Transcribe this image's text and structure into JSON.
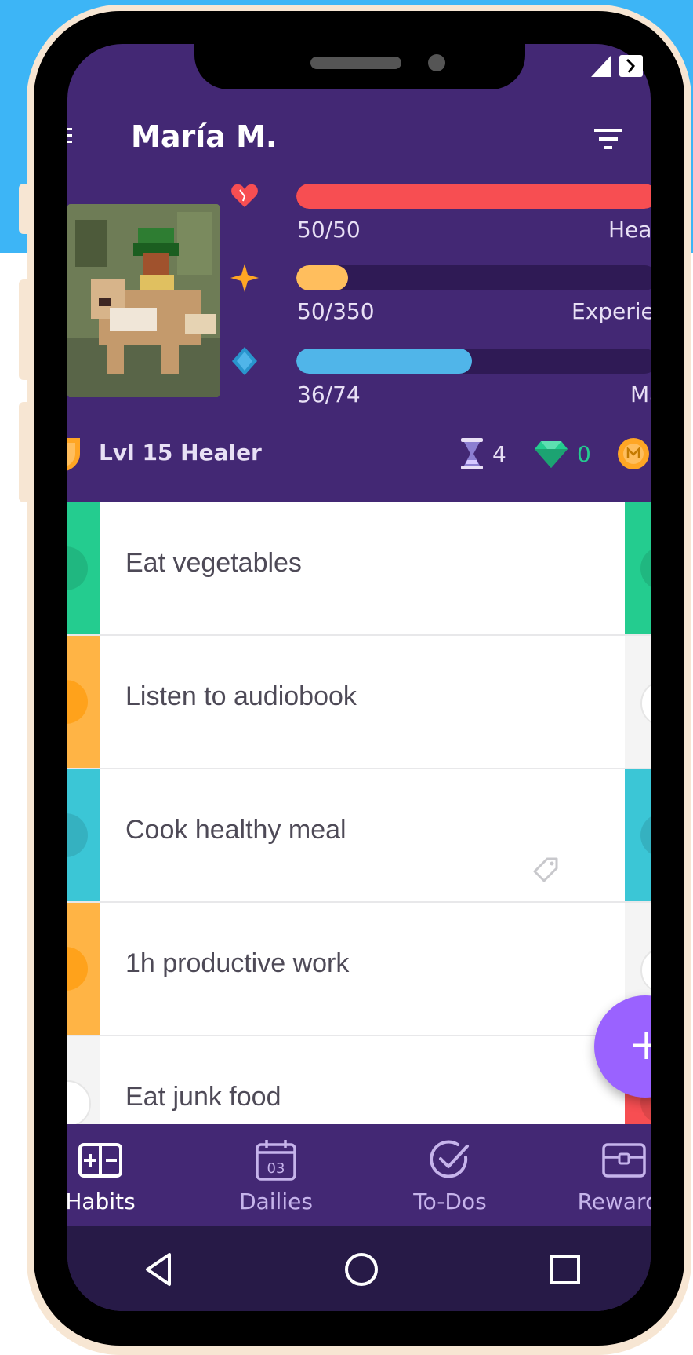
{
  "header": {
    "title": "María M.",
    "colors": {
      "background": "#432874",
      "accent": "#9a62ff"
    }
  },
  "stats": {
    "health": {
      "value": "50/50",
      "label": "Health",
      "fraction": 1.0,
      "color": "#f74e52"
    },
    "experience": {
      "value": "50/350",
      "label": "Experience",
      "fraction": 0.143,
      "color": "#ffbe5d"
    },
    "mana": {
      "value": "36/74",
      "label": "Mana",
      "fraction": 0.486,
      "color": "#50b5e9"
    }
  },
  "profile": {
    "level_class": "Lvl 15 Healer",
    "hourglasses": "4",
    "gems": "0"
  },
  "tasks": [
    {
      "text": "Eat vegetables",
      "left_color": "#24cc8f",
      "right_color": "#24cc8f"
    },
    {
      "text": "Listen to audiobook",
      "left_color": "#ffb445",
      "right_color": "#f4f4f4"
    },
    {
      "text": "Cook healthy meal",
      "left_color": "#3bc6d6",
      "right_color": "#3bc6d6"
    },
    {
      "text": "1h productive work",
      "left_color": "#ffb445",
      "right_color": "#f4f4f4"
    },
    {
      "text": "Eat junk food",
      "left_color": "#f4f4f4",
      "right_color": "#f74e52"
    }
  ],
  "fab": {
    "symbol": "+"
  },
  "nav": [
    {
      "label": "Habits"
    },
    {
      "label": "Dailies",
      "date": "03"
    },
    {
      "label": "To-Dos"
    },
    {
      "label": "Rewards"
    }
  ]
}
